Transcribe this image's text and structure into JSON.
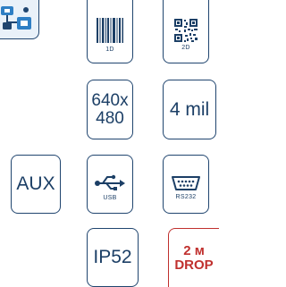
{
  "tiles": {
    "barcode_1d": {
      "label": "1D"
    },
    "barcode_2d": {
      "label": "2D"
    },
    "resolution": {
      "label": "640x\n480"
    },
    "min_bar": {
      "label": "4 mil"
    },
    "aux": {
      "label": "AUX"
    },
    "usb": {
      "label": "USB"
    },
    "rs232": {
      "label": "RS232"
    },
    "ip_rating": {
      "label": "IP52"
    },
    "drop": {
      "line1": "2 м",
      "line2": "DROP"
    }
  },
  "colors": {
    "primary": "#1c3f66",
    "border": "#20456f",
    "drop": "#c0302e",
    "logo_bg": "#e9f1f9",
    "logo_accent": "#2f7fc4"
  },
  "icons": {
    "logo": "network-devices-icon",
    "barcode_1d": "barcode-1d-icon",
    "barcode_2d": "qr-code-icon",
    "usb": "usb-icon",
    "rs232": "serial-port-icon"
  }
}
